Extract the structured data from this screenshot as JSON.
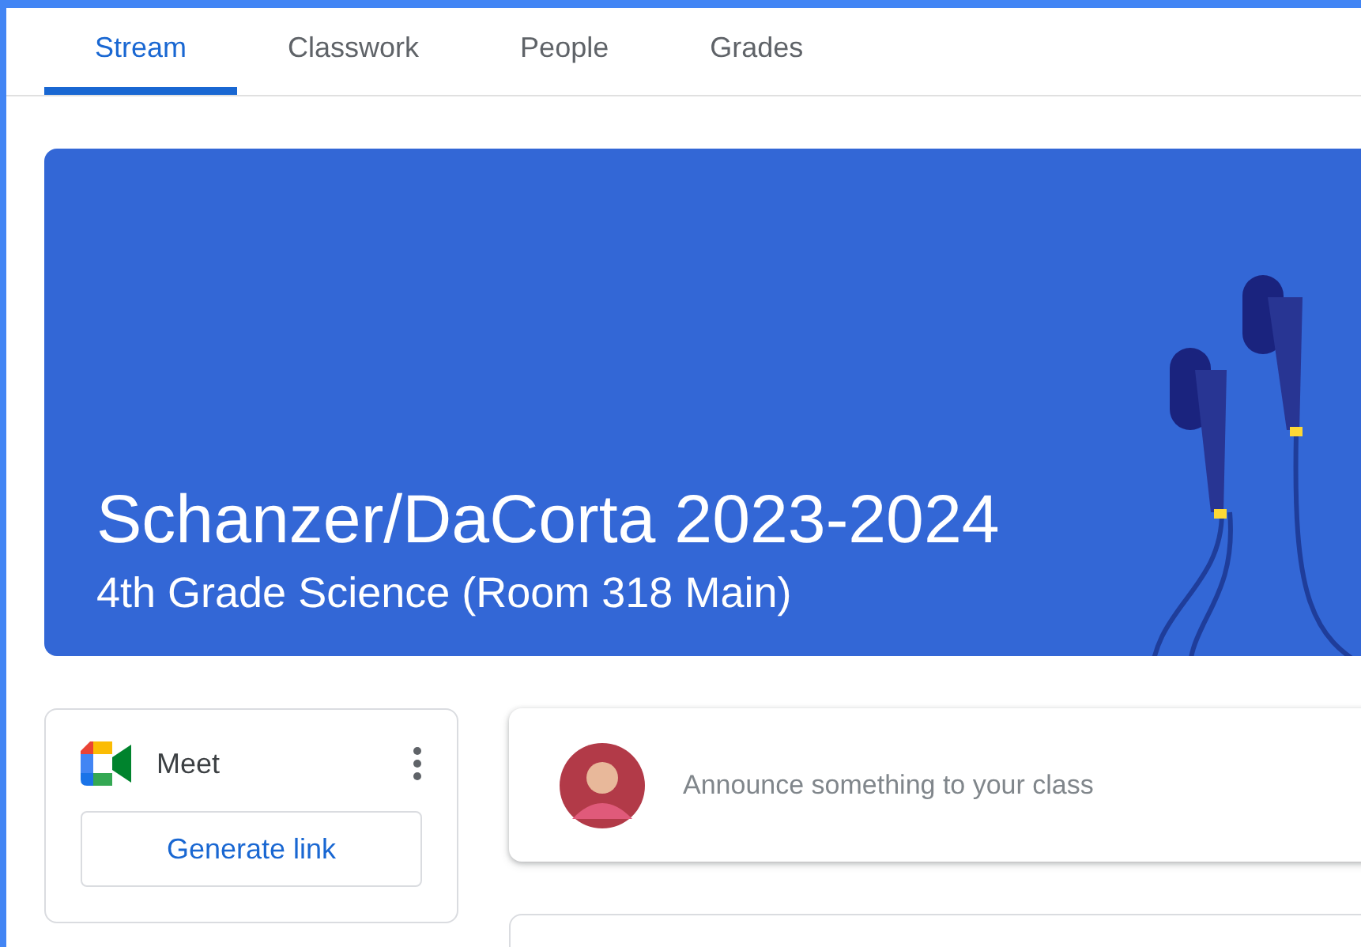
{
  "tabs": [
    {
      "label": "Stream",
      "selected": true
    },
    {
      "label": "Classwork",
      "selected": false
    },
    {
      "label": "People",
      "selected": false
    },
    {
      "label": "Grades",
      "selected": false
    }
  ],
  "banner": {
    "title": "Schanzer/DaCorta 2023-2024",
    "subtitle": "4th Grade Science (Room 318 Main)"
  },
  "meet": {
    "title": "Meet",
    "button": "Generate link"
  },
  "announce": {
    "placeholder": "Announce something to your class"
  }
}
